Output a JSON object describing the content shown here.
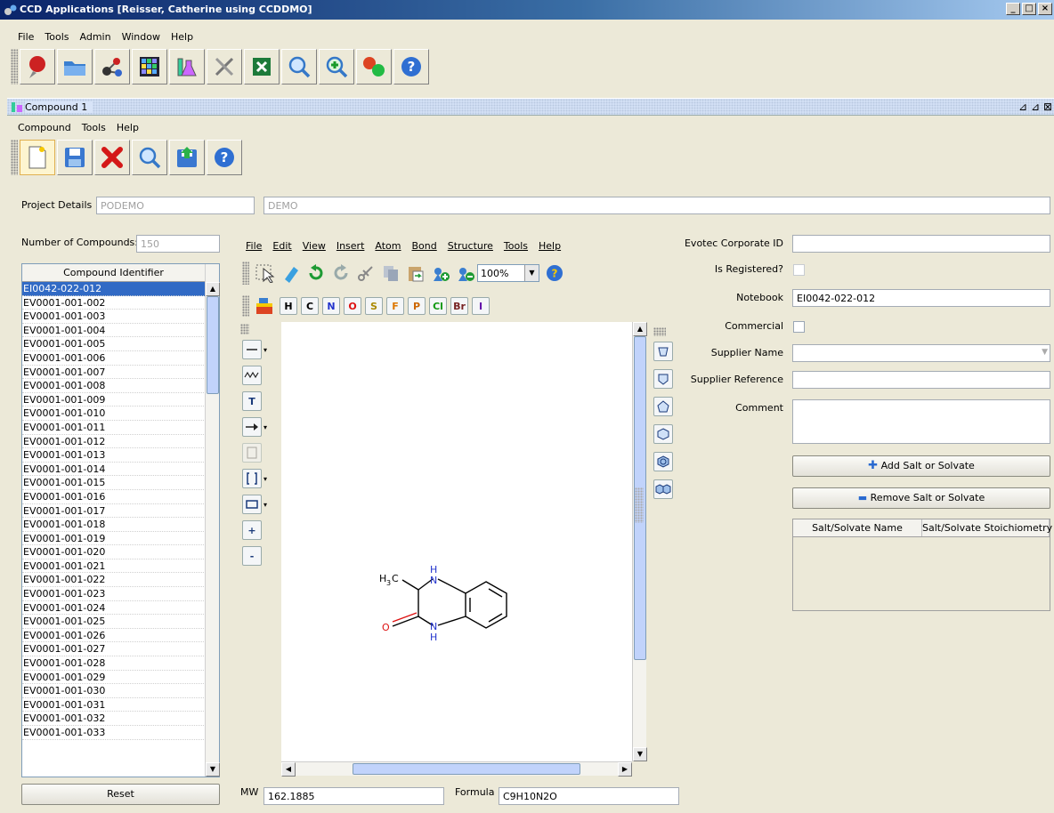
{
  "window": {
    "title": "CCD Applications [Reisser, Catherine using CCDDMO]"
  },
  "main_menu": [
    "File",
    "Tools",
    "Admin",
    "Window",
    "Help"
  ],
  "main_toolbar_icons": [
    "pin-icon",
    "folder-icon",
    "molecule-icon",
    "grid-icon",
    "lab-icon",
    "tools-icon",
    "excel-icon",
    "search-icon",
    "search-plus-icon",
    "spheres-icon",
    "help-icon"
  ],
  "internal_frame": {
    "title": "Compound 1"
  },
  "compound_menu": [
    "Compound",
    "Tools",
    "Help"
  ],
  "project": {
    "label": "Project Details",
    "code": "PODEMO",
    "name": "DEMO"
  },
  "compounds": {
    "count_label": "Number of Compounds:",
    "count": "150",
    "header": "Compound Identifier",
    "items": [
      "EI0042-022-012",
      "EV0001-001-002",
      "EV0001-001-003",
      "EV0001-001-004",
      "EV0001-001-005",
      "EV0001-001-006",
      "EV0001-001-007",
      "EV0001-001-008",
      "EV0001-001-009",
      "EV0001-001-010",
      "EV0001-001-011",
      "EV0001-001-012",
      "EV0001-001-013",
      "EV0001-001-014",
      "EV0001-001-015",
      "EV0001-001-016",
      "EV0001-001-017",
      "EV0001-001-018",
      "EV0001-001-019",
      "EV0001-001-020",
      "EV0001-001-021",
      "EV0001-001-022",
      "EV0001-001-023",
      "EV0001-001-024",
      "EV0001-001-025",
      "EV0001-001-026",
      "EV0001-001-027",
      "EV0001-001-028",
      "EV0001-001-029",
      "EV0001-001-030",
      "EV0001-001-031",
      "EV0001-001-032",
      "EV0001-001-033"
    ],
    "reset_label": "Reset"
  },
  "editor": {
    "menu": [
      "File",
      "Edit",
      "View",
      "Insert",
      "Atom",
      "Bond",
      "Structure",
      "Tools",
      "Help"
    ],
    "zoom": "100%",
    "atoms": [
      {
        "label": "H",
        "color": "#000000"
      },
      {
        "label": "C",
        "color": "#000000"
      },
      {
        "label": "N",
        "color": "#2233cc"
      },
      {
        "label": "O",
        "color": "#dd1111"
      },
      {
        "label": "S",
        "color": "#aa8800"
      },
      {
        "label": "F",
        "color": "#dd7700"
      },
      {
        "label": "P",
        "color": "#cc6600"
      },
      {
        "label": "Cl",
        "color": "#119911"
      },
      {
        "label": "Br",
        "color": "#772222"
      },
      {
        "label": "I",
        "color": "#6611aa"
      }
    ],
    "side_tools": [
      "T",
      "+",
      "-"
    ],
    "molecule_labels": {
      "methyl": "H",
      "methyl_sub": "3",
      "methyl_c": "C",
      "n_top": "N",
      "h_top": "H",
      "n_bottom": "N",
      "h_bottom": "H",
      "oxygen": "O"
    },
    "mw_label": "MW",
    "mw": "162.1885",
    "formula_label": "Formula",
    "formula": "C9H10N2O"
  },
  "form": {
    "corporate_id_label": "Evotec Corporate ID",
    "corporate_id": "",
    "registered_label": "Is Registered?",
    "notebook_label": "Notebook",
    "notebook": "EI0042-022-012",
    "commercial_label": "Commercial",
    "supplier_name_label": "Supplier Name",
    "supplier_name": "",
    "supplier_ref_label": "Supplier Reference",
    "supplier_ref": "",
    "comment_label": "Comment",
    "comment": "",
    "add_salt_label": "Add Salt or Solvate",
    "remove_salt_label": "Remove Salt or Solvate",
    "salt_table_headers": [
      "Salt/Solvate Name",
      "Salt/Solvate Stoichiometry"
    ]
  }
}
